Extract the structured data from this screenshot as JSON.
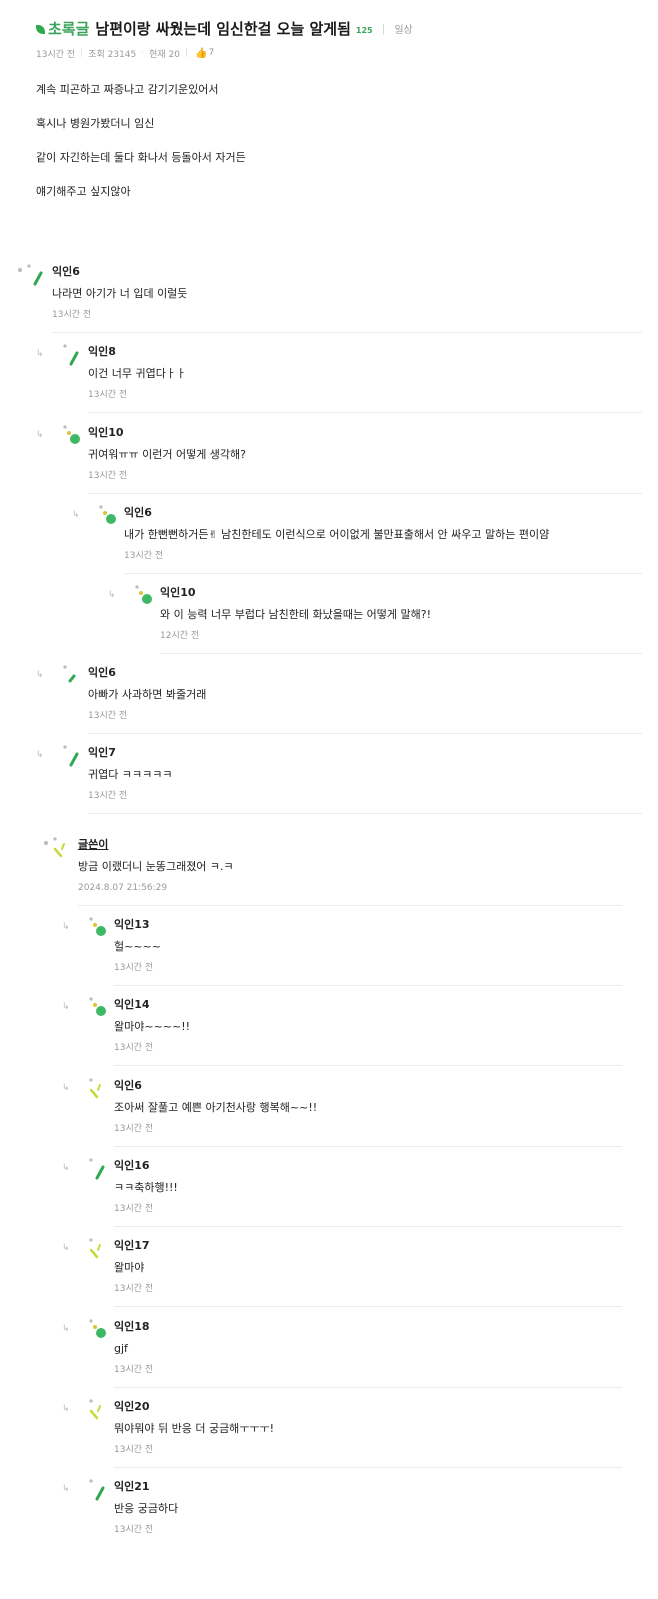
{
  "post": {
    "board": "초록글",
    "title": "남편이랑 싸웠는데 임신한걸 오늘 알게됨",
    "reply_count": "125",
    "category": "일상",
    "time": "13시간 전",
    "views": "조회 23145",
    "current": "현재 20",
    "likes": "7",
    "body": [
      "계속 피곤하고 짜증나고 감기기운있어서",
      "혹시나 병원가봤더니 임신",
      "같이 자긴하는데 둘다 화나서 등돌아서 자거든",
      "얘기해주고 싶지않아"
    ]
  },
  "comments": [
    {
      "author": "익인6",
      "text": "나라면 아기가 너 입데 이럴듯",
      "time": "13시간 전"
    },
    {
      "author": "익인8",
      "text": "이건 너무 귀엽다ㅏㅏ",
      "time": "13시간 전"
    },
    {
      "author": "익인10",
      "text": "귀여워ㅠㅠ 이런거 어떻게 생각해?",
      "time": "13시간 전"
    },
    {
      "author": "익인6",
      "text": "내가 한뻔뻔하거든✌ 남친한테도 이런식으로 어이없게 불만표출해서 안 싸우고 말하는 편이얌",
      "time": "13시간 전"
    },
    {
      "author": "익인10",
      "text": "와 이 능력 너무 부럽다 남친한테 화났을때는 어떻게 말해?!",
      "time": "12시간 전"
    },
    {
      "author": "익인6",
      "text": "아빠가 사과하면 봐줄거래",
      "time": "13시간 전"
    },
    {
      "author": "익인7",
      "text": "귀엽다 ㅋㅋㅋㅋㅋ",
      "time": "13시간 전"
    },
    {
      "author": "글쓴이",
      "text": "방금 이랬더니 눈똥그래졌어 ㅋ.ㅋ",
      "time": "2024.8.07 21:56:29"
    },
    {
      "author": "익인13",
      "text": "헐~~~~",
      "time": "13시간 전"
    },
    {
      "author": "익인14",
      "text": "왈마야~~~~!!",
      "time": "13시간 전"
    },
    {
      "author": "익인6",
      "text": "조아써 잘풀고 예쁜 아기천사랑 행복해~~!!",
      "time": "13시간 전"
    },
    {
      "author": "익인16",
      "text": "ㅋㅋ축하행!!!",
      "time": "13시간 전"
    },
    {
      "author": "익인17",
      "text": "왈마야",
      "time": "13시간 전"
    },
    {
      "author": "익인18",
      "text": "gjf",
      "time": "13시간 전"
    },
    {
      "author": "익인20",
      "text": "뭐야뭐야 뒤 반응 더 궁금해ㅜㅜㅜ!",
      "time": "13시간 전"
    },
    {
      "author": "익인21",
      "text": "반응 궁금하다",
      "time": "13시간 전"
    }
  ],
  "icons": {
    "leaf": "leaf-icon",
    "thumb": "thumbs-up-icon",
    "reply": "reply-arrow-icon"
  },
  "colors": {
    "accent_green": "#3aa35a",
    "meta_gray": "#9a9a9a"
  }
}
